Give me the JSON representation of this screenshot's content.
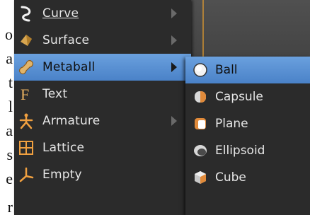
{
  "edge_letters": [
    "o",
    "a",
    "t",
    "l",
    "a",
    "s",
    "e",
    "r"
  ],
  "menu": {
    "items": [
      {
        "label": "Curve",
        "icon": "curve-icon",
        "has_submenu": true
      },
      {
        "label": "Surface",
        "icon": "surface-icon",
        "has_submenu": true
      },
      {
        "label": "Metaball",
        "icon": "metaball-icon",
        "has_submenu": true,
        "active": true
      },
      {
        "label": "Text",
        "icon": "text-icon",
        "has_submenu": false
      },
      {
        "label": "Armature",
        "icon": "armature-icon",
        "has_submenu": true
      },
      {
        "label": "Lattice",
        "icon": "lattice-icon",
        "has_submenu": false
      },
      {
        "label": "Empty",
        "icon": "empty-icon",
        "has_submenu": false
      }
    ]
  },
  "submenu": {
    "items": [
      {
        "label": "Ball",
        "icon": "ball-icon",
        "active": true
      },
      {
        "label": "Capsule",
        "icon": "capsule-icon"
      },
      {
        "label": "Plane",
        "icon": "plane-icon"
      },
      {
        "label": "Ellipsoid",
        "icon": "ellipsoid-icon"
      },
      {
        "label": "Cube",
        "icon": "cube-icon"
      }
    ]
  },
  "colors": {
    "menu_bg": "#2b2b2b",
    "highlight": "#5a90d4",
    "text": "#e6e6e6"
  }
}
